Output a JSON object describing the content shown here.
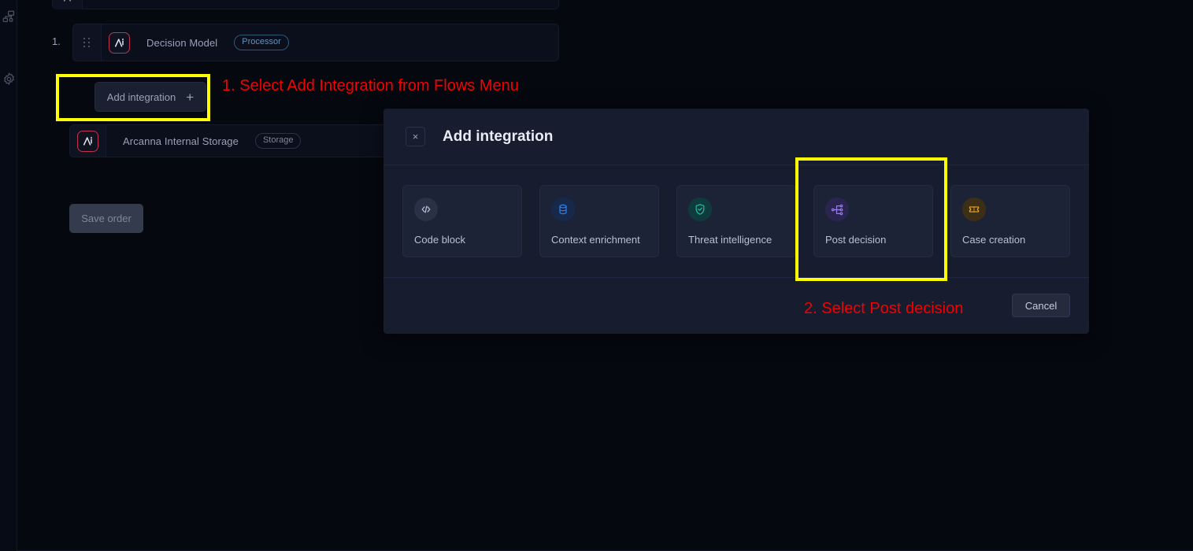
{
  "colors": {
    "page_bg": "#05080f",
    "modal_bg": "#171c2e",
    "card_bg": "#1d2336",
    "highlight": "#ffff00",
    "annotation_red": "#f40000",
    "arcanna_red": "#c0334d"
  },
  "sidebar": {
    "items": [
      {
        "name": "flows-icon",
        "label": "Flows"
      },
      {
        "name": "settings-icon",
        "label": "Settings"
      }
    ]
  },
  "flow_list": {
    "index_label": "1.",
    "rows": [
      {
        "name": "Decision Model",
        "badge": "Processor",
        "badge_type": "processor"
      },
      {
        "name": "Arcanna Internal Storage",
        "badge": "Storage",
        "badge_type": "storage"
      }
    ],
    "add_integration_label": "Add integration",
    "add_integration_plus": "+",
    "save_order_label": "Save order"
  },
  "annotations": [
    {
      "text": "1. Select Add Integration from Flows Menu"
    },
    {
      "text": "2. Select Post decision"
    }
  ],
  "modal": {
    "title": "Add integration",
    "close_label": "×",
    "cancel_label": "Cancel",
    "cards": [
      {
        "label": "Code block",
        "icon": "code-block-icon",
        "icon_color": "#b9c2d6",
        "icon_bg": "#2a3045",
        "selected": false
      },
      {
        "label": "Context enrichment",
        "icon": "database-icon",
        "icon_color": "#2f7ff0",
        "icon_bg": "#17294a",
        "selected": false
      },
      {
        "label": "Threat intelligence",
        "icon": "shield-check-icon",
        "icon_color": "#1fbfa0",
        "icon_bg": "#103b3c",
        "selected": false
      },
      {
        "label": "Post decision",
        "icon": "hierarchy-branch-icon",
        "icon_color": "#9a7bf0",
        "icon_bg": "#2a2550",
        "selected": true
      },
      {
        "label": "Case creation",
        "icon": "ticket-icon",
        "icon_color": "#f0a22a",
        "icon_bg": "#3d2f15",
        "selected": false
      }
    ]
  }
}
